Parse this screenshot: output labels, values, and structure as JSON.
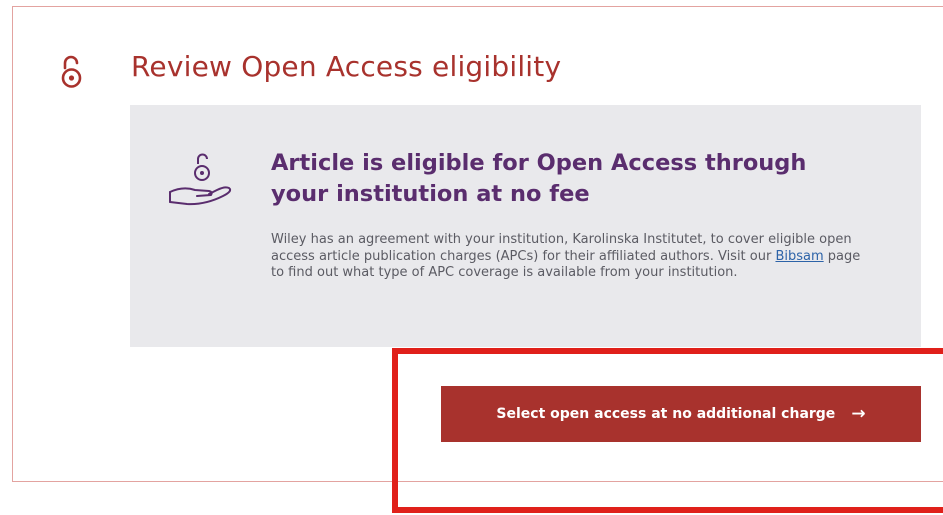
{
  "panel": {
    "title": "Review Open Access eligibility",
    "icon": "open-access-lock-icon",
    "accent_color": "#a8322d"
  },
  "eligibility": {
    "icon": "hand-with-open-lock-icon",
    "title": "Article is eligible for Open Access through your institution at no fee",
    "body_before_link": "Wiley has an agreement with your institution, Karolinska Institutet, to cover eligible open access article publication charges (APCs) for their affiliated authors. Visit our ",
    "link_text": "Bibsam",
    "body_after_link": " page to find out what type of APC coverage is available from your institution.",
    "title_color": "#5a2d6e",
    "background_color": "#e9e9ec"
  },
  "action": {
    "button_label": "Select open access at no additional charge",
    "arrow": "→",
    "highlight_color": "#e0201a"
  }
}
